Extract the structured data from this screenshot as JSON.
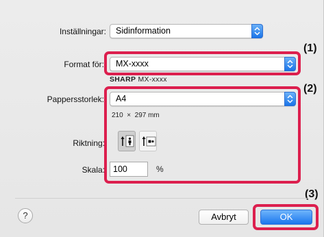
{
  "settings": {
    "label": "Inställningar:",
    "value": "Sidinformation"
  },
  "format_for": {
    "label": "Format för:",
    "value": "MX-xxxx",
    "sublabel_brand": "SHARP",
    "sublabel_model": "MX-xxxx"
  },
  "paper_size": {
    "label": "Pappersstorlek:",
    "value": "A4",
    "dimensions": "210  ×  297 mm"
  },
  "orientation": {
    "label": "Riktning:",
    "options": [
      "portrait",
      "landscape"
    ],
    "selected": "portrait"
  },
  "scale": {
    "label": "Skala:",
    "value": "100",
    "unit": "%"
  },
  "callouts": [
    "(1)",
    "(2)",
    "(3)"
  ],
  "buttons": {
    "help": "?",
    "cancel": "Avbryt",
    "ok": "OK"
  },
  "colors": {
    "highlight": "#dc1f4e",
    "accent": "#1b76ee"
  }
}
